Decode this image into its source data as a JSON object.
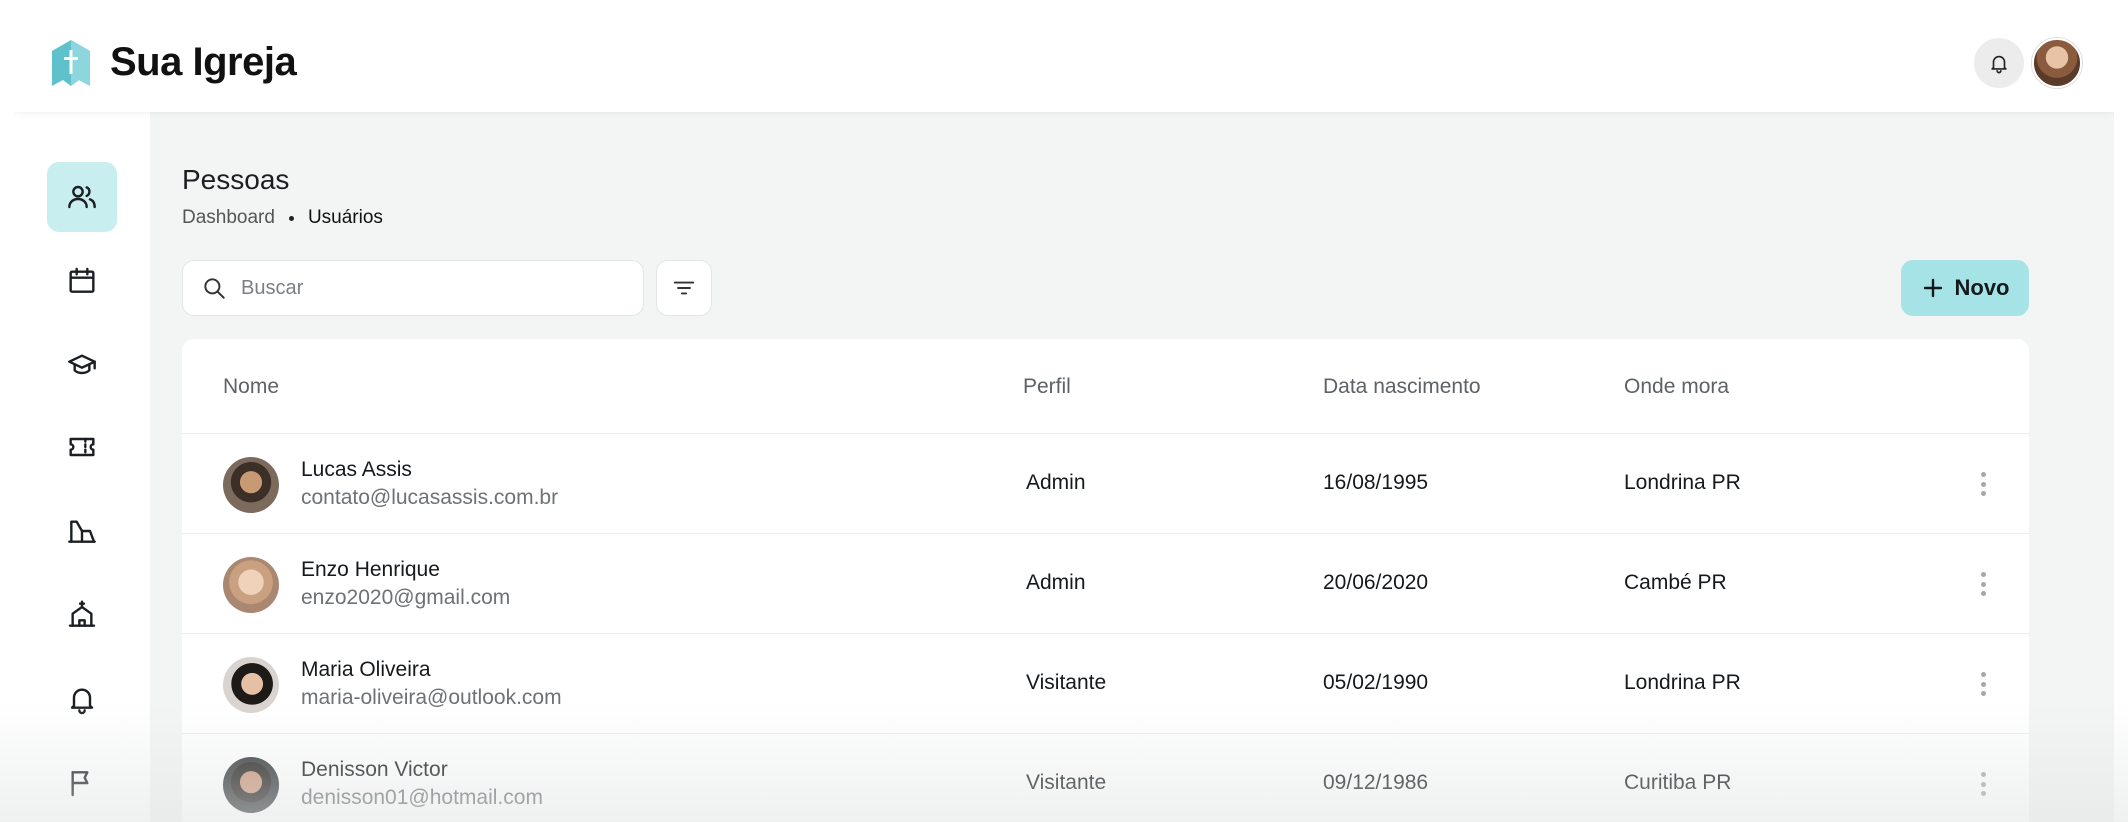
{
  "brand": {
    "name": "Sua Igreja"
  },
  "page": {
    "title": "Pessoas"
  },
  "breadcrumb": {
    "items": [
      "Dashboard",
      "Usuários"
    ]
  },
  "search": {
    "placeholder": "Buscar",
    "value": ""
  },
  "actions": {
    "new_label": "Novo"
  },
  "colors": {
    "accent": "#a6e3e6",
    "active_nav": "#c9eef0",
    "logo": "#5fc1cc",
    "background": "#f3f5f4"
  },
  "sidebar": {
    "items": [
      {
        "icon": "users-icon",
        "active": true
      },
      {
        "icon": "calendar-icon",
        "active": false
      },
      {
        "icon": "graduation-cap-icon",
        "active": false
      },
      {
        "icon": "ticket-icon",
        "active": false
      },
      {
        "icon": "building-icon",
        "active": false
      },
      {
        "icon": "church-icon",
        "active": false
      },
      {
        "icon": "bell-icon",
        "active": false
      },
      {
        "icon": "flag-icon",
        "active": false
      }
    ]
  },
  "table": {
    "headers": {
      "name": "Nome",
      "profile": "Perfil",
      "birth": "Data nascimento",
      "location": "Onde mora"
    },
    "rows": [
      {
        "name": "Lucas Assis",
        "email": "contato@lucasassis.com.br",
        "profile": "Admin",
        "birth": "16/08/1995",
        "location": "Londrina PR"
      },
      {
        "name": "Enzo Henrique",
        "email": "enzo2020@gmail.com",
        "profile": "Admin",
        "birth": "20/06/2020",
        "location": "Cambé PR"
      },
      {
        "name": "Maria Oliveira",
        "email": "maria-oliveira@outlook.com",
        "profile": "Visitante",
        "birth": "05/02/1990",
        "location": "Londrina PR"
      },
      {
        "name": "Denisson Victor",
        "email": "denisson01@hotmail.com",
        "profile": "Visitante",
        "birth": "09/12/1986",
        "location": "Curitiba PR"
      }
    ]
  }
}
